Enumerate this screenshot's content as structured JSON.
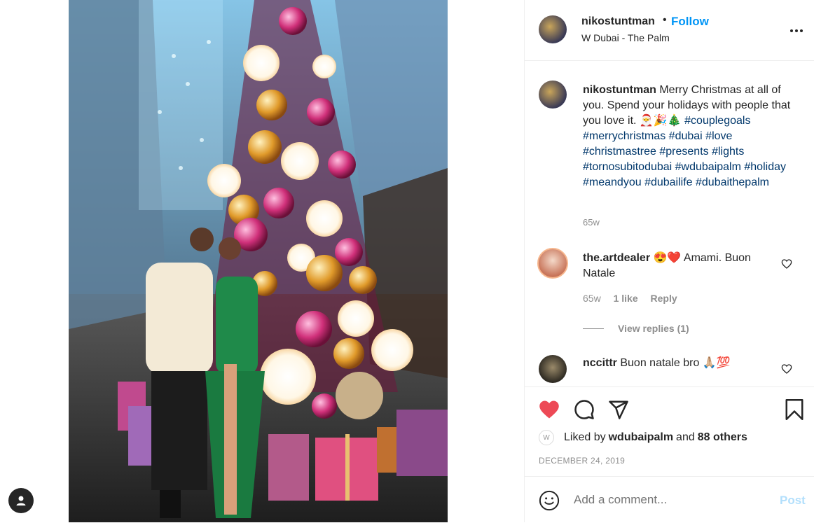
{
  "post": {
    "username": "nikostuntman",
    "separator": "•",
    "follow_label": "Follow",
    "location": "W Dubai - The Palm"
  },
  "caption": {
    "username": "nikostuntman",
    "text": "Merry Christmas at all of you. Spend your holidays with people that you love it. 🎅🎉🎄",
    "hashtags": "#couplegoals #merrychristmas #dubai #love #christmastree #presents #lights #tornosubitodubai #wdubaipalm #holiday #meandyou #dubailife #dubaithepalm",
    "time": "65w"
  },
  "comments": [
    {
      "username": "the.artdealer",
      "text": "😍❤️ Amami. Buon Natale",
      "time": "65w",
      "likes": "1 like",
      "reply_label": "Reply",
      "view_replies": "View replies (1)"
    },
    {
      "username": "nccittr",
      "text": "Buon natale bro 🙏🏼💯"
    }
  ],
  "actions": {
    "liked_by_prefix": "Liked by",
    "liked_by_user": "wdubaipalm",
    "liked_by_join": "and",
    "liked_by_others": "88 others",
    "date": "DECEMBER 24, 2019"
  },
  "add_comment": {
    "placeholder": "Add a comment...",
    "post_label": "Post"
  },
  "colors": {
    "link": "#0095f6",
    "hashtag": "#00376b",
    "like_red": "#ed4956",
    "muted": "#8e8e8e"
  },
  "icons": [
    "user-icon",
    "more-icon",
    "heart-icon",
    "comment-icon",
    "share-icon",
    "bookmark-icon",
    "smile-icon"
  ]
}
